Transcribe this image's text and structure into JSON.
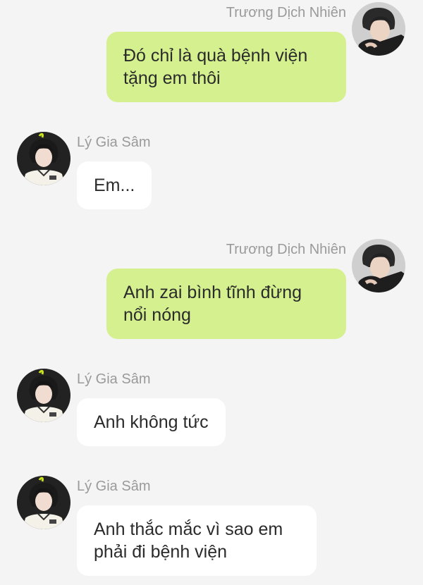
{
  "messages": [
    {
      "side": "right",
      "sender": "Trương Dịch Nhiên",
      "avatar": "user-avatar-truong",
      "text": "Đó chỉ là quà bệnh viện tặng em thôi"
    },
    {
      "side": "left",
      "sender": "Lý Gia Sâm",
      "avatar": "user-avatar-ly",
      "text": "Em..."
    },
    {
      "side": "right",
      "sender": "Trương Dịch Nhiên",
      "avatar": "user-avatar-truong",
      "text": "Anh zai bình tĩnh đừng nổi nóng"
    },
    {
      "side": "left",
      "sender": "Lý Gia Sâm",
      "avatar": "user-avatar-ly",
      "text": "Anh không tức"
    },
    {
      "side": "left",
      "sender": "Lý Gia Sâm",
      "avatar": "user-avatar-ly",
      "text": "Anh thắc mắc vì sao em phải đi bệnh viện"
    }
  ],
  "colors": {
    "background": "#f4f4f4",
    "outgoing_bubble": "#d5f08e",
    "incoming_bubble": "#ffffff",
    "sender_name": "#9a9a9a"
  }
}
